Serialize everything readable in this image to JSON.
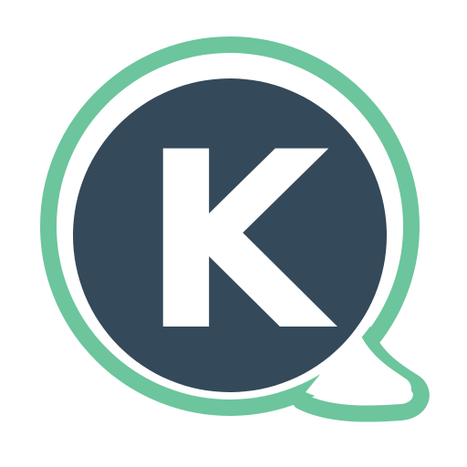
{
  "app_icon": {
    "letter": "K",
    "icon_name": "speech-bubble-logo-icon",
    "colors": {
      "background": "#ffffff",
      "bubble_outline": "#6cc59d",
      "inner_circle": "#34495a",
      "letter": "#ffffff"
    }
  }
}
